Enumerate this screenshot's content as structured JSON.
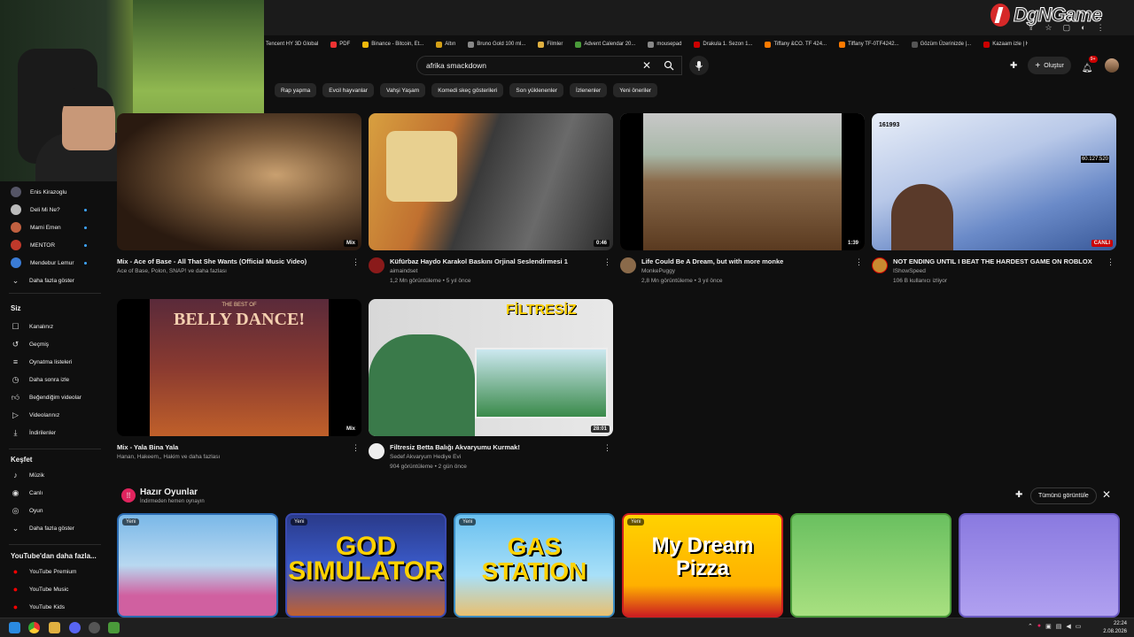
{
  "bookmarks": [
    "Tencent HY 3D Global",
    "PDF",
    "Binance - Bitcoin, Et...",
    "Altın",
    "Bruno Gold 100 ml...",
    "Filmler",
    "Advent Calendar 20...",
    "mousepad",
    "Drakula 1. Sezon 1...",
    "Tiffany &CO. TF 424...",
    "Tiffany TF-0TF4242...",
    "Gözüm Üzerinizde |...",
    "Kazaam izle | Hdfilm..."
  ],
  "watermark": "DgNGame",
  "search": {
    "value": "afrika smackdown"
  },
  "header": {
    "create_label": "Oluştur",
    "notif_count": "9+"
  },
  "chips": [
    "Rap yapma",
    "Evcil hayvanlar",
    "Vahşi Yaşam",
    "Komedi skeç gösterileri",
    "Son yüklenenler",
    "İzlenenler",
    "Yeni öneriler"
  ],
  "subscriptions": [
    {
      "name": "Enis Kirazoglu",
      "color": "#556",
      "dot": false
    },
    {
      "name": "Deli Mi Ne?",
      "color": "#bbb",
      "dot": true
    },
    {
      "name": "Mami Emen",
      "color": "#c06040",
      "dot": true
    },
    {
      "name": "MENTOR",
      "color": "#c0392b",
      "dot": true
    },
    {
      "name": "Mendebur Lemur",
      "color": "#3a7bd5",
      "dot": true
    }
  ],
  "sidebar": {
    "more_subs": "Daha fazla göster",
    "you_header": "Siz",
    "you_items": [
      "Kanalınız",
      "Geçmiş",
      "Oynatma listeleri",
      "Daha sonra izle",
      "Beğendiğim videolar",
      "Videolarınız",
      "İndirilenler"
    ],
    "explore_header": "Keşfet",
    "explore_items": [
      "Müzik",
      "Canlı",
      "Oyun",
      "Daha fazla göster"
    ],
    "more_header": "YouTube'dan daha fazla...",
    "more_items": [
      "YouTube Premium",
      "YouTube Music",
      "YouTube Kids"
    ]
  },
  "videos": [
    {
      "title": "Mix - Ace of Base - All That She Wants (Official Music Video)",
      "channel": "Ace of Base, Polon, SNAP! ve daha fazlası",
      "meta": "",
      "badge": "Mix"
    },
    {
      "title": "Küfürbaz Haydo  Karakol Baskını Orjinal Seslendirmesi 1",
      "channel": "aimaindset",
      "meta": "1,2 Mn görüntüleme • 5 yıl önce",
      "badge": "0:46"
    },
    {
      "title": "Life Could Be A Dream, but with more monke",
      "channel": "MonkePuggy",
      "meta": "2,8 Mn görüntüleme • 3 yıl önce",
      "badge": "1:39"
    },
    {
      "title": "NOT ENDING UNTIL I BEAT THE HARDEST GAME ON ROBLOX",
      "channel": "IShowSpeed",
      "meta": "106 B kullanıcı izliyor",
      "badge": "CANLI"
    },
    {
      "title": "Mix - Yala Bina Yala",
      "channel": "Hanan, Hakeem,, Hakim ve daha fazlası",
      "meta": "",
      "badge": "Mix"
    },
    {
      "title": "Filtresiz Betta Balığı Akvaryumu Kurmak!",
      "channel": "Sedef Akvaryum Hediye Evi",
      "meta": "904 görüntüleme • 2 gün önce",
      "badge": "28:01"
    }
  ],
  "thumb_text": {
    "belly": "BELLY DANCE!",
    "belly_small": "THE BEST OF",
    "filtresiz": "FİLTRESİZ",
    "roblox_count": "161993",
    "roblox_count2": "60.127.520"
  },
  "games": {
    "title": "Hazır Oyunlar",
    "subtitle": "İndirmeden hemen oynayın",
    "see_all": "Tümünü görüntüle",
    "new_badge": "Yeni",
    "items": [
      "",
      "GOD SIMULATOR",
      "GAS STATION",
      "My Dream Pizza",
      "",
      ""
    ]
  },
  "clock": {
    "time": "22:24",
    "date": "2.08.2026"
  }
}
